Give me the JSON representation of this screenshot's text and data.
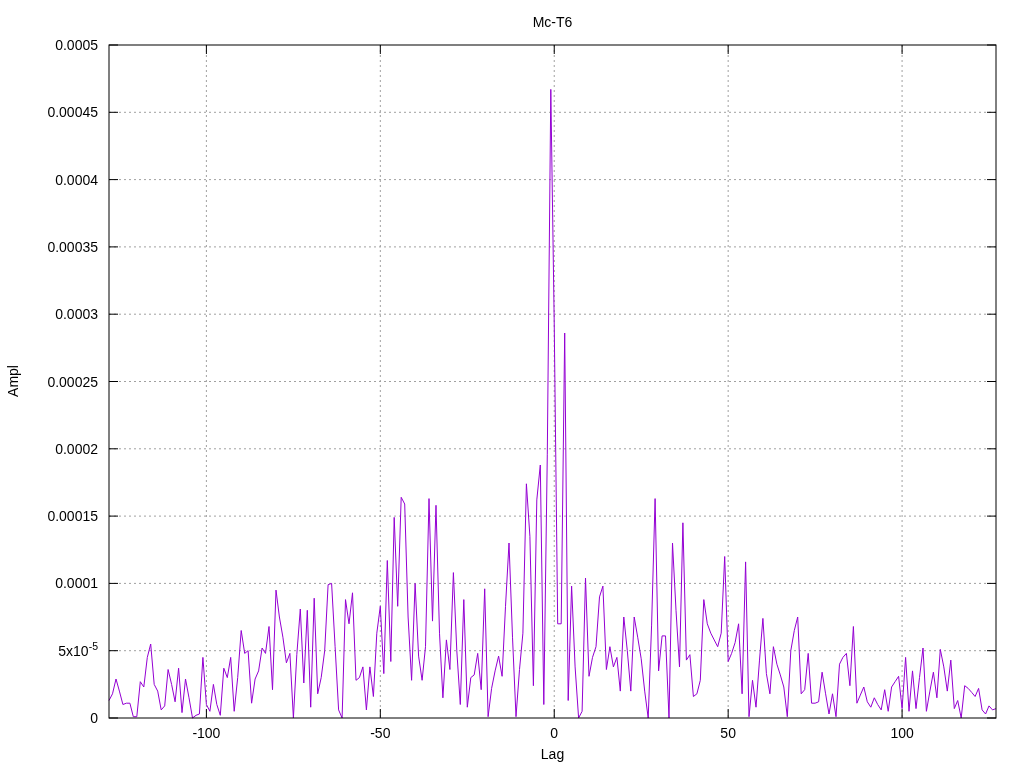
{
  "chart_data": {
    "type": "line",
    "grid": true,
    "title": "Mc-T6",
    "xlabel": "Lag",
    "ylabel": "Ampl",
    "xlim": [
      -128,
      127
    ],
    "ylim": [
      0,
      0.0005
    ],
    "xticks": [
      -100,
      -50,
      0,
      50,
      100
    ],
    "yticks": [
      {
        "value": 0,
        "label": "0"
      },
      {
        "value": 5e-05,
        "label": "5x10$^{-5}$"
      },
      {
        "value": 0.0001,
        "label": "0.0001"
      },
      {
        "value": 0.00015,
        "label": "0.00015"
      },
      {
        "value": 0.0002,
        "label": "0.0002"
      },
      {
        "value": 0.00025,
        "label": "0.00025"
      },
      {
        "value": 0.0003,
        "label": "0.0003"
      },
      {
        "value": 0.00035,
        "label": "0.00035"
      },
      {
        "value": 0.0004,
        "label": "0.0004"
      },
      {
        "value": 0.00045,
        "label": "0.00045"
      },
      {
        "value": 0.0005,
        "label": "0.0005"
      }
    ],
    "x": [
      -128,
      -127,
      -126,
      -125,
      -124,
      -123,
      -122,
      -121,
      -120,
      -119,
      -118,
      -117,
      -116,
      -115,
      -114,
      -113,
      -112,
      -111,
      -110,
      -109,
      -108,
      -107,
      -106,
      -105,
      -104,
      -103,
      -102,
      -101,
      -100,
      -99,
      -98,
      -97,
      -96,
      -95,
      -94,
      -93,
      -92,
      -91,
      -90,
      -89,
      -88,
      -87,
      -86,
      -85,
      -84,
      -83,
      -82,
      -81,
      -80,
      -79,
      -78,
      -77,
      -76,
      -75,
      -74,
      -73,
      -72,
      -71,
      -70,
      -69,
      -68,
      -67,
      -66,
      -65,
      -64,
      -63,
      -62,
      -61,
      -60,
      -59,
      -58,
      -57,
      -56,
      -55,
      -54,
      -53,
      -52,
      -51,
      -50,
      -49,
      -48,
      -47,
      -46,
      -45,
      -44,
      -43,
      -42,
      -41,
      -40,
      -39,
      -38,
      -37,
      -36,
      -35,
      -34,
      -33,
      -32,
      -31,
      -30,
      -29,
      -28,
      -27,
      -26,
      -25,
      -24,
      -23,
      -22,
      -21,
      -20,
      -19,
      -18,
      -17,
      -16,
      -15,
      -14,
      -13,
      -12,
      -11,
      -10,
      -9,
      -8,
      -7,
      -6,
      -5,
      -4,
      -3,
      -2,
      -1,
      0,
      1,
      2,
      3,
      4,
      5,
      6,
      7,
      8,
      9,
      10,
      11,
      12,
      13,
      14,
      15,
      16,
      17,
      18,
      19,
      20,
      21,
      22,
      23,
      24,
      25,
      26,
      27,
      28,
      29,
      30,
      31,
      32,
      33,
      34,
      35,
      36,
      37,
      38,
      39,
      40,
      41,
      42,
      43,
      44,
      45,
      46,
      47,
      48,
      49,
      50,
      51,
      52,
      53,
      54,
      55,
      56,
      57,
      58,
      59,
      60,
      61,
      62,
      63,
      64,
      65,
      66,
      67,
      68,
      69,
      70,
      71,
      72,
      73,
      74,
      75,
      76,
      77,
      78,
      79,
      80,
      81,
      82,
      83,
      84,
      85,
      86,
      87,
      88,
      89,
      90,
      91,
      92,
      93,
      94,
      95,
      96,
      97,
      98,
      99,
      100,
      101,
      102,
      103,
      104,
      105,
      106,
      107,
      108,
      109,
      110,
      111,
      112,
      113,
      114,
      115,
      116,
      117,
      118,
      119,
      120,
      121,
      122,
      123,
      124,
      125,
      126,
      127
    ],
    "series": [
      {
        "color": "#9400d3",
        "values": [
          1.3e-05,
          1.8e-05,
          2.9e-05,
          2e-05,
          1e-05,
          1.1e-05,
          1.1e-05,
          1e-06,
          1e-06,
          2.7e-05,
          2.3e-05,
          4.5e-05,
          5.5e-05,
          2.5e-05,
          2e-05,
          6e-06,
          9e-06,
          3.6e-05,
          2.5e-05,
          1.2e-05,
          3.7e-05,
          4e-06,
          2.9e-05,
          1.5e-05,
          0,
          2e-06,
          3e-06,
          4.5e-05,
          1e-05,
          5e-06,
          2.5e-05,
          1e-05,
          2e-06,
          3.7e-05,
          3e-05,
          4.5e-05,
          5e-06,
          3e-05,
          6.5e-05,
          4.8e-05,
          5e-05,
          1.1e-05,
          2.9e-05,
          3.5e-05,
          5.2e-05,
          4.8e-05,
          6.8e-05,
          2.1e-05,
          9.5e-05,
          7.5e-05,
          6e-05,
          4.1e-05,
          4.8e-05,
          0,
          4.7e-05,
          8.1e-05,
          2.6e-05,
          8e-05,
          8e-06,
          8.9e-05,
          1.8e-05,
          3e-05,
          5e-05,
          9.9e-05,
          0.0001,
          5.3e-05,
          6e-06,
          0,
          8.8e-05,
          7e-05,
          9.3e-05,
          2.8e-05,
          3e-05,
          3.8e-05,
          6e-06,
          3.8e-05,
          1.6e-05,
          6.3e-05,
          8.3e-05,
          3.3e-05,
          0.000117,
          4.2e-05,
          0.000149,
          8.3e-05,
          0.000164,
          0.000159,
          7.5e-05,
          2.8e-05,
          0.0001,
          4.6e-05,
          2.8e-05,
          5.3e-05,
          0.000163,
          7.2e-05,
          0.000158,
          6.3e-05,
          1.5e-05,
          5.8e-05,
          3.6e-05,
          0.000108,
          5e-05,
          1e-05,
          8.8e-05,
          8e-06,
          3e-05,
          3.2e-05,
          4.8e-05,
          2.1e-05,
          9.6e-05,
          1e-06,
          2.2e-05,
          3.5e-05,
          4.6e-05,
          3.1e-05,
          8.3e-05,
          0.00013,
          6e-05,
          1e-06,
          3.6e-05,
          6.3e-05,
          0.000174,
          0.000135,
          2.4e-05,
          0.000162,
          0.000188,
          1e-05,
          0.000196,
          0.000467,
          0.000295,
          7e-05,
          7e-05,
          0.000286,
          1.3e-05,
          9.8e-05,
          3.8e-05,
          0,
          5e-06,
          0.000104,
          3.1e-05,
          4.5e-05,
          5.3e-05,
          9e-05,
          9.8e-05,
          3.6e-05,
          5.3e-05,
          3.8e-05,
          4.5e-05,
          2e-05,
          7.5e-05,
          5e-05,
          2e-05,
          7.5e-05,
          6e-05,
          4.4e-05,
          2e-05,
          0,
          6.9e-05,
          0.000163,
          3.5e-05,
          6.1e-05,
          6.1e-05,
          0,
          0.00013,
          8e-05,
          3.8e-05,
          0.000145,
          4.3e-05,
          4.7e-05,
          1.6e-05,
          1.8e-05,
          2.8e-05,
          8.8e-05,
          7e-05,
          6.3e-05,
          5.8e-05,
          5.3e-05,
          6.3e-05,
          0.00012,
          4.2e-05,
          4.8e-05,
          5.6e-05,
          7e-05,
          1.8e-05,
          0.000116,
          1e-06,
          2.8e-05,
          8e-06,
          4.3e-05,
          7.4e-05,
          3.3e-05,
          1.8e-05,
          5.3e-05,
          4e-05,
          3.2e-05,
          2.3e-05,
          1e-06,
          5e-05,
          6.5e-05,
          7.5e-05,
          1.8e-05,
          2.1e-05,
          4.8e-05,
          1.1e-05,
          1.1e-05,
          1.2e-05,
          3.4e-05,
          1.8e-05,
          3e-06,
          1.8e-05,
          1e-06,
          4e-05,
          4.5e-05,
          4.8e-05,
          2.4e-05,
          6.8e-05,
          1.1e-05,
          1.7e-05,
          2.3e-05,
          1.2e-05,
          8e-06,
          1.5e-05,
          1e-05,
          6e-06,
          2.1e-05,
          5e-06,
          2.3e-05,
          2.7e-05,
          3.1e-05,
          7e-06,
          4.5e-05,
          5e-06,
          3.5e-05,
          7e-06,
          3e-05,
          5.2e-05,
          5e-06,
          2e-05,
          3.4e-05,
          1.5e-05,
          5.1e-05,
          3.8e-05,
          2e-05,
          4.3e-05,
          7e-06,
          1.3e-05,
          0,
          2.4e-05,
          2.2e-05,
          1.9e-05,
          1.6e-05,
          2.2e-05,
          6e-06,
          3e-06,
          9e-06,
          6e-06,
          7e-06
        ]
      }
    ]
  }
}
